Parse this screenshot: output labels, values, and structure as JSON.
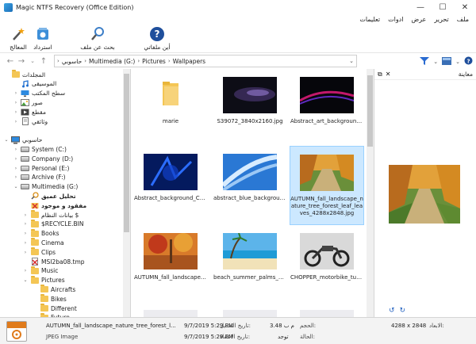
{
  "window": {
    "title": "Magic NTFS Recovery (Office Edition)",
    "min": "—",
    "max": "☐",
    "close": "✕"
  },
  "menu": [
    "ملف",
    "تحرير",
    "عرض",
    "ادوات",
    "تعليمات"
  ],
  "toolbar": {
    "wizard": "المعالج",
    "recover": "استرداد",
    "find": "بحث عن ملف",
    "where": "أين ملفاتي"
  },
  "address": {
    "segments": [
      "حاسوبي",
      "Multimedia (G:)",
      "Pictures",
      "Wallpapers"
    ]
  },
  "tree": {
    "items": [
      {
        "label": "المجلدات",
        "level": 0,
        "icon": "folder",
        "exp": ""
      },
      {
        "label": "الموسيقى",
        "level": 1,
        "icon": "music",
        "exp": ""
      },
      {
        "label": "سطح المكتب",
        "level": 1,
        "icon": "desktop",
        "exp": "›"
      },
      {
        "label": "صور",
        "level": 1,
        "icon": "pictures",
        "exp": "›"
      },
      {
        "label": "مقطع",
        "level": 1,
        "icon": "video",
        "exp": "›"
      },
      {
        "label": "وثائقي",
        "level": 1,
        "icon": "documents",
        "exp": "›"
      },
      {
        "label": "",
        "level": 0,
        "icon": "",
        "exp": ""
      },
      {
        "label": "حاسوبي",
        "level": 0,
        "icon": "computer",
        "exp": "⌄"
      },
      {
        "label": "System (C:)",
        "level": 1,
        "icon": "drive",
        "exp": "›"
      },
      {
        "label": "Company (D:)",
        "level": 1,
        "icon": "drive",
        "exp": "›"
      },
      {
        "label": "Personal (E:)",
        "level": 1,
        "icon": "drive",
        "exp": "›"
      },
      {
        "label": "Archive (F:)",
        "level": 1,
        "icon": "drive",
        "exp": "›"
      },
      {
        "label": "Multimedia (G:)",
        "level": 1,
        "icon": "drive",
        "exp": "⌄"
      },
      {
        "label": "تحليل عميق",
        "level": 2,
        "icon": "search",
        "exp": "",
        "bold": true
      },
      {
        "label": "مفقود و موجود",
        "level": 2,
        "icon": "lost",
        "exp": "",
        "bold": true
      },
      {
        "label": "بيانات النظام $",
        "level": 2,
        "icon": "folder",
        "exp": "›"
      },
      {
        "label": "$RECYCLE.BIN",
        "level": 2,
        "icon": "folder",
        "exp": "›"
      },
      {
        "label": "Books",
        "level": 2,
        "icon": "folder",
        "exp": "›"
      },
      {
        "label": "Cinema",
        "level": 2,
        "icon": "folder",
        "exp": "›"
      },
      {
        "label": "Clips",
        "level": 2,
        "icon": "folder",
        "exp": "›"
      },
      {
        "label": "MSI2ba08.tmp",
        "level": 2,
        "icon": "deleted",
        "exp": ""
      },
      {
        "label": "Music",
        "level": 2,
        "icon": "folder",
        "exp": "›"
      },
      {
        "label": "Pictures",
        "level": 2,
        "icon": "folder",
        "exp": "⌄"
      },
      {
        "label": "Aircrafts",
        "level": 3,
        "icon": "folder",
        "exp": ""
      },
      {
        "label": "Bikes",
        "level": 3,
        "icon": "folder",
        "exp": ""
      },
      {
        "label": "Different",
        "level": 3,
        "icon": "folder",
        "exp": ""
      },
      {
        "label": "Future",
        "level": 3,
        "icon": "folder",
        "exp": ""
      }
    ]
  },
  "grid": {
    "files": [
      {
        "name": "marie",
        "kind": "folder"
      },
      {
        "name": "S39072_3840x2160.jpg",
        "kind": "dark-purple"
      },
      {
        "name": "Abstract_art_background_Blu...",
        "kind": "dark-red"
      },
      {
        "name": "Abstract_background_Colorf...",
        "kind": "blue-dark"
      },
      {
        "name": "abstract_blue_background_4...",
        "kind": "blue-light"
      },
      {
        "name": "AUTUMN_fall_landscape_nature_tree_forest_leaf_leaves_4288x2848.jpg",
        "kind": "autumn",
        "selected": true
      },
      {
        "name": "AUTUMN_fall_landscape_nat...",
        "kind": "autumn2"
      },
      {
        "name": "beach_summer_palms_ocea...",
        "kind": "beach"
      },
      {
        "name": "CHOPPER_motorbike_tuning...",
        "kind": "bike"
      }
    ]
  },
  "preview": {
    "title": "معاينة"
  },
  "status": {
    "file_name": "AUTUMN_fall_landscape_nature_tree_forest_l...",
    "file_type": "JPEG Image",
    "modified_label": "تاريخ التعديل:",
    "modified_value": "9/7/2019 5:29 PM",
    "created_label": "تاريخ الانشاء:",
    "created_value": "9/7/2019 5:29 PM",
    "size_label": "الحجم:",
    "size_value": "3.48 م ب",
    "dim_label": "الابعاد:",
    "dim_value": "4288 x 2848",
    "state_label": "الحالة:",
    "state_value": "توجد"
  }
}
